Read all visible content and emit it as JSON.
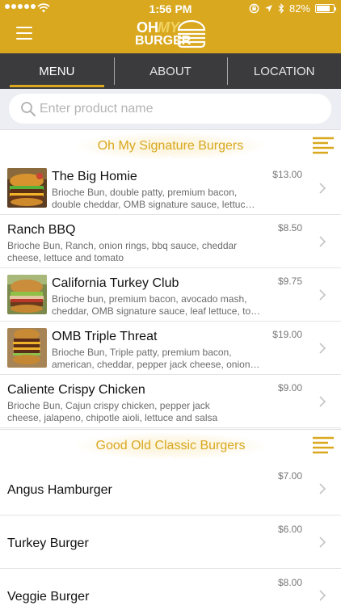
{
  "status_bar": {
    "time": "1:56 PM",
    "battery": "82%",
    "battery_level": 0.82
  },
  "brand": {
    "logo_oh": "OH",
    "logo_my": "MY",
    "logo_burger": "BURGER",
    "accent_color": "#d9a81f",
    "tabbar_color": "#3b3b3d"
  },
  "tabs": [
    {
      "label": "MENU",
      "active": true
    },
    {
      "label": "ABOUT",
      "active": false
    },
    {
      "label": "LOCATION",
      "active": false
    }
  ],
  "search": {
    "placeholder": "Enter product name",
    "value": ""
  },
  "sections": [
    {
      "title": "Oh My Signature Burgers",
      "items": [
        {
          "name": "The Big Homie",
          "desc": "Brioche Bun, double patty, premium bacon, double cheddar, OMB signature sauce, lettuc…",
          "price": "$13.00",
          "thumb_icon": "burger-photo-icon"
        },
        {
          "name": "Ranch BBQ",
          "desc": "Brioche Bun, Ranch, onion rings, bbq sauce, cheddar cheese, lettuce and tomato",
          "price": "$8.50"
        },
        {
          "name": "California Turkey Club",
          "desc": "Brioche bun, premium bacon, avocado mash, cheddar, OMB signature sauce, leaf lettuce, to…",
          "price": "$9.75",
          "thumb_icon": "burger-photo-icon"
        },
        {
          "name": "OMB Triple Threat",
          "desc": "Brioche Bun, Triple patty, premium bacon, american, cheddar, pepper jack cheese, onion…",
          "price": "$19.00",
          "thumb_icon": "burger-photo-icon"
        },
        {
          "name": "Caliente Crispy Chicken",
          "desc": "Brioche Bun, Cajun crispy chicken, pepper jack cheese, jalapeno, chipotle aioli, lettuce and salsa",
          "price": "$9.00"
        }
      ]
    },
    {
      "title": "Good Old Classic Burgers",
      "items": [
        {
          "name": "Angus Hamburger",
          "price": "$7.00"
        },
        {
          "name": "Turkey Burger",
          "price": "$6.00"
        },
        {
          "name": "Veggie Burger",
          "price": "$8.00"
        }
      ]
    }
  ]
}
